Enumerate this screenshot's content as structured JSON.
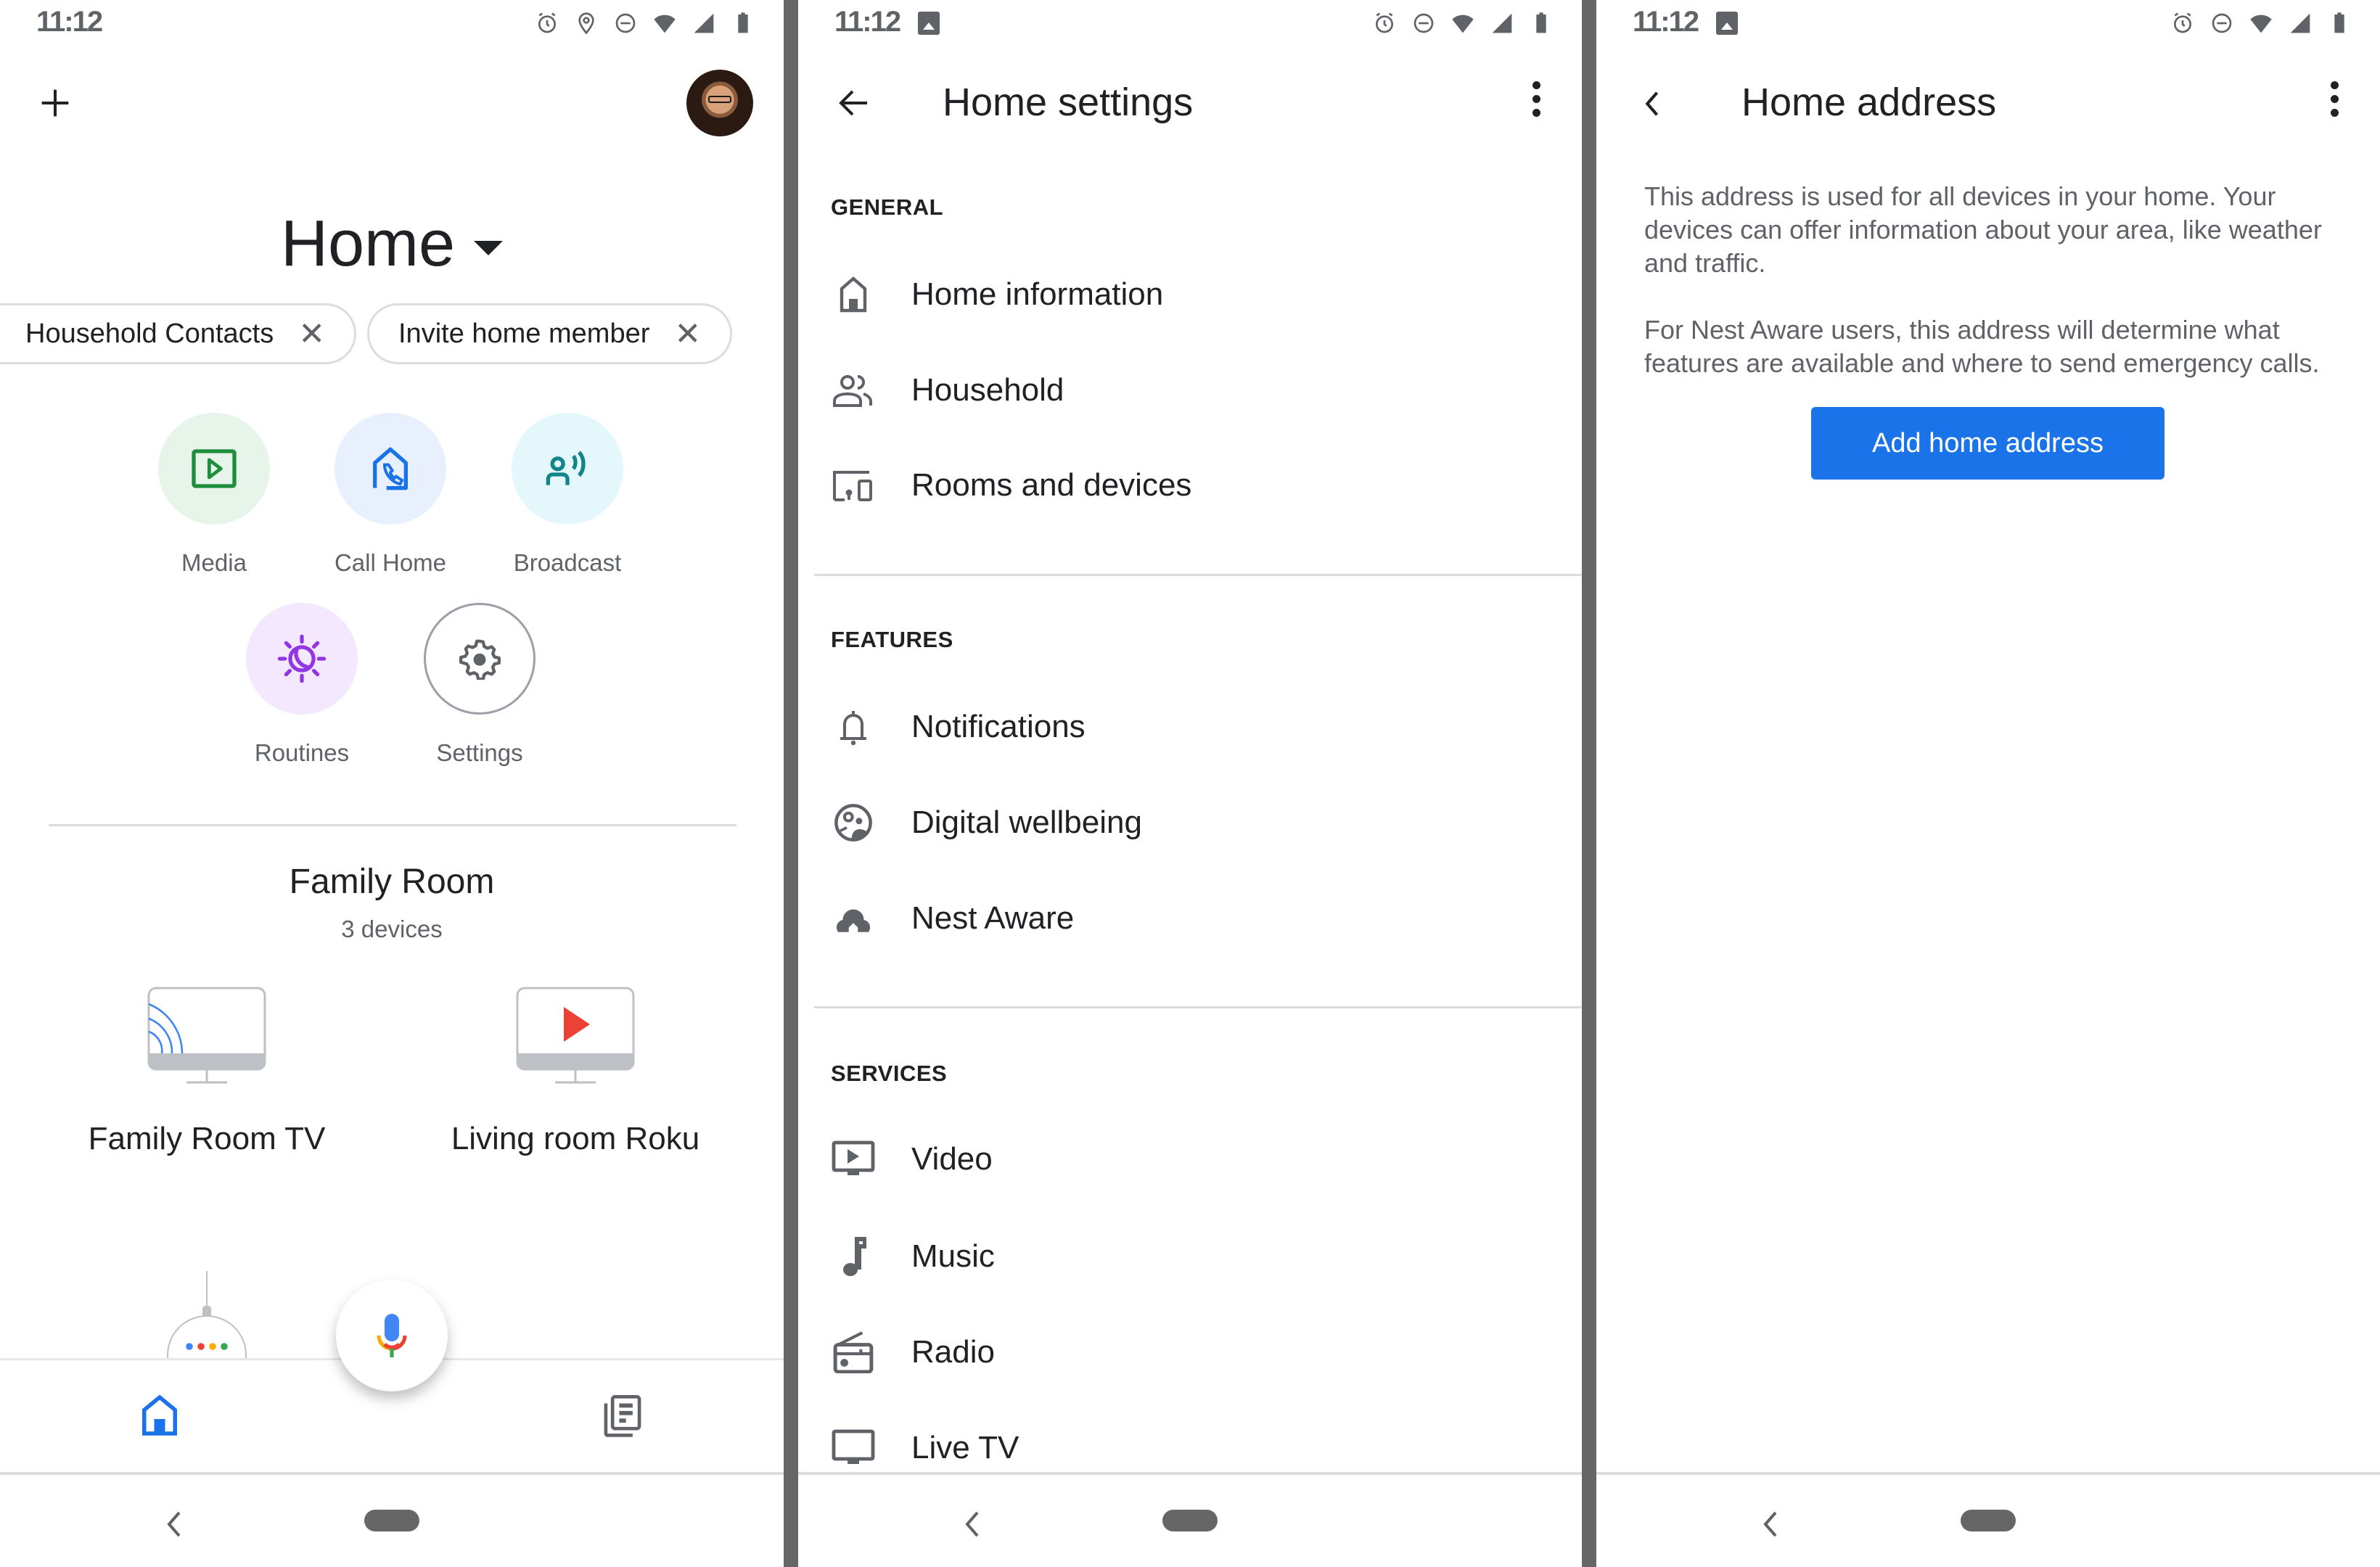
{
  "status_bar": {
    "time": "11:12",
    "icons": [
      "alarm-icon",
      "location-icon",
      "do-not-disturb-icon",
      "wifi-icon",
      "signal-icon",
      "battery-icon"
    ]
  },
  "home_screen": {
    "title": "Home",
    "chips": [
      {
        "label": "Household Contacts",
        "close_icon": "close-icon"
      },
      {
        "label": "Invite home member",
        "close_icon": "close-icon"
      }
    ],
    "actions": [
      {
        "label": "Media",
        "icon": "media-play-icon",
        "bg": "#e6f4ea",
        "color": "#1e8e3e"
      },
      {
        "label": "Call Home",
        "icon": "call-home-icon",
        "bg": "#e8f0fe",
        "color": "#1a73e8"
      },
      {
        "label": "Broadcast",
        "icon": "broadcast-icon",
        "bg": "#e4f7fb",
        "color": "#12858a"
      },
      {
        "label": "Routines",
        "icon": "routines-icon",
        "bg": "#f3e8fd",
        "color": "#9334e6"
      },
      {
        "label": "Settings",
        "icon": "gear-icon",
        "bg": "#ffffff",
        "color": "#5f6368"
      }
    ],
    "room": {
      "name": "Family Room",
      "device_count": "3 devices",
      "devices": [
        {
          "name": "Family Room TV",
          "icon": "cast-tv-icon"
        },
        {
          "name": "Living room Roku",
          "icon": "roku-tv-icon"
        }
      ]
    },
    "bottom_nav": [
      {
        "name": "home-tab",
        "icon": "home-icon",
        "active": true
      },
      {
        "name": "feed-tab",
        "icon": "feed-icon",
        "active": false
      }
    ],
    "accent": "#1a73e8"
  },
  "home_settings": {
    "title": "Home settings",
    "sections": [
      {
        "header": "GENERAL",
        "items": [
          {
            "label": "Home information",
            "icon": "home-icon"
          },
          {
            "label": "Household",
            "icon": "people-icon"
          },
          {
            "label": "Rooms and devices",
            "icon": "devices-icon"
          }
        ]
      },
      {
        "header": "FEATURES",
        "items": [
          {
            "label": "Notifications",
            "icon": "bell-icon"
          },
          {
            "label": "Digital wellbeing",
            "icon": "wellbeing-icon"
          },
          {
            "label": "Nest Aware",
            "icon": "nest-aware-icon"
          }
        ]
      },
      {
        "header": "SERVICES",
        "items": [
          {
            "label": "Video",
            "icon": "video-icon"
          },
          {
            "label": "Music",
            "icon": "music-note-icon"
          },
          {
            "label": "Radio",
            "icon": "radio-icon"
          },
          {
            "label": "Live TV",
            "icon": "tv-icon"
          }
        ]
      }
    ]
  },
  "home_address": {
    "title": "Home address",
    "paragraph1": "This address is used for all devices in your home. Your devices can offer information about your area, like weather and traffic.",
    "paragraph2": "For Nest Aware users, this address will determine what features are available and where to send emergency calls.",
    "button_label": "Add home address",
    "button_color": "#1a73e8"
  }
}
